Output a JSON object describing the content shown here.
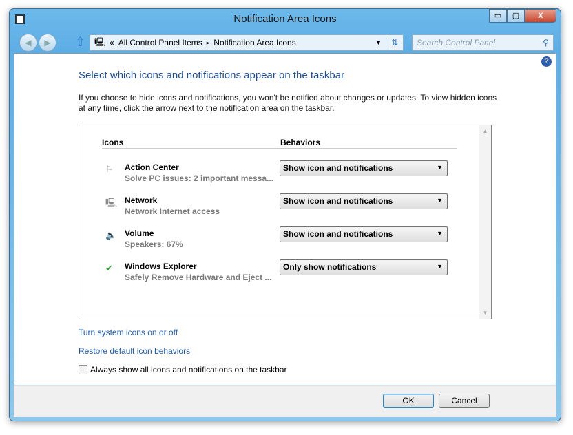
{
  "window": {
    "title": "Notification Area Icons",
    "minimize": "▭",
    "maximize": "▢",
    "close": "X"
  },
  "address": {
    "prefix": "«",
    "crumbs": [
      "All Control Panel Items",
      "Notification Area Icons"
    ],
    "sep": "▸"
  },
  "search": {
    "placeholder": "Search Control Panel"
  },
  "main": {
    "heading": "Select which icons and notifications appear on the taskbar",
    "description": "If you choose to hide icons and notifications, you won't be notified about changes or updates. To view hidden icons at any time, click the arrow next to the notification area on the taskbar.",
    "col_icons": "Icons",
    "col_behaviors": "Behaviors",
    "rows": [
      {
        "name": "Action Center",
        "detail": "Solve PC issues: 2 important messa...",
        "behavior": "Show icon and notifications",
        "icon": "⚐"
      },
      {
        "name": "Network",
        "detail": "Network  Internet access",
        "behavior": "Show icon and notifications",
        "icon": "🖳"
      },
      {
        "name": "Volume",
        "detail": "Speakers: 67%",
        "behavior": "Show icon and notifications",
        "icon": "🔈"
      },
      {
        "name": "Windows Explorer",
        "detail": "Safely Remove Hardware and Eject ...",
        "behavior": "Only show notifications",
        "icon": "✔"
      }
    ],
    "link_system_icons": "Turn system icons on or off",
    "link_restore": "Restore default icon behaviors",
    "checkbox_label": "Always show all icons and notifications on the taskbar"
  },
  "footer": {
    "ok": "OK",
    "cancel": "Cancel"
  }
}
